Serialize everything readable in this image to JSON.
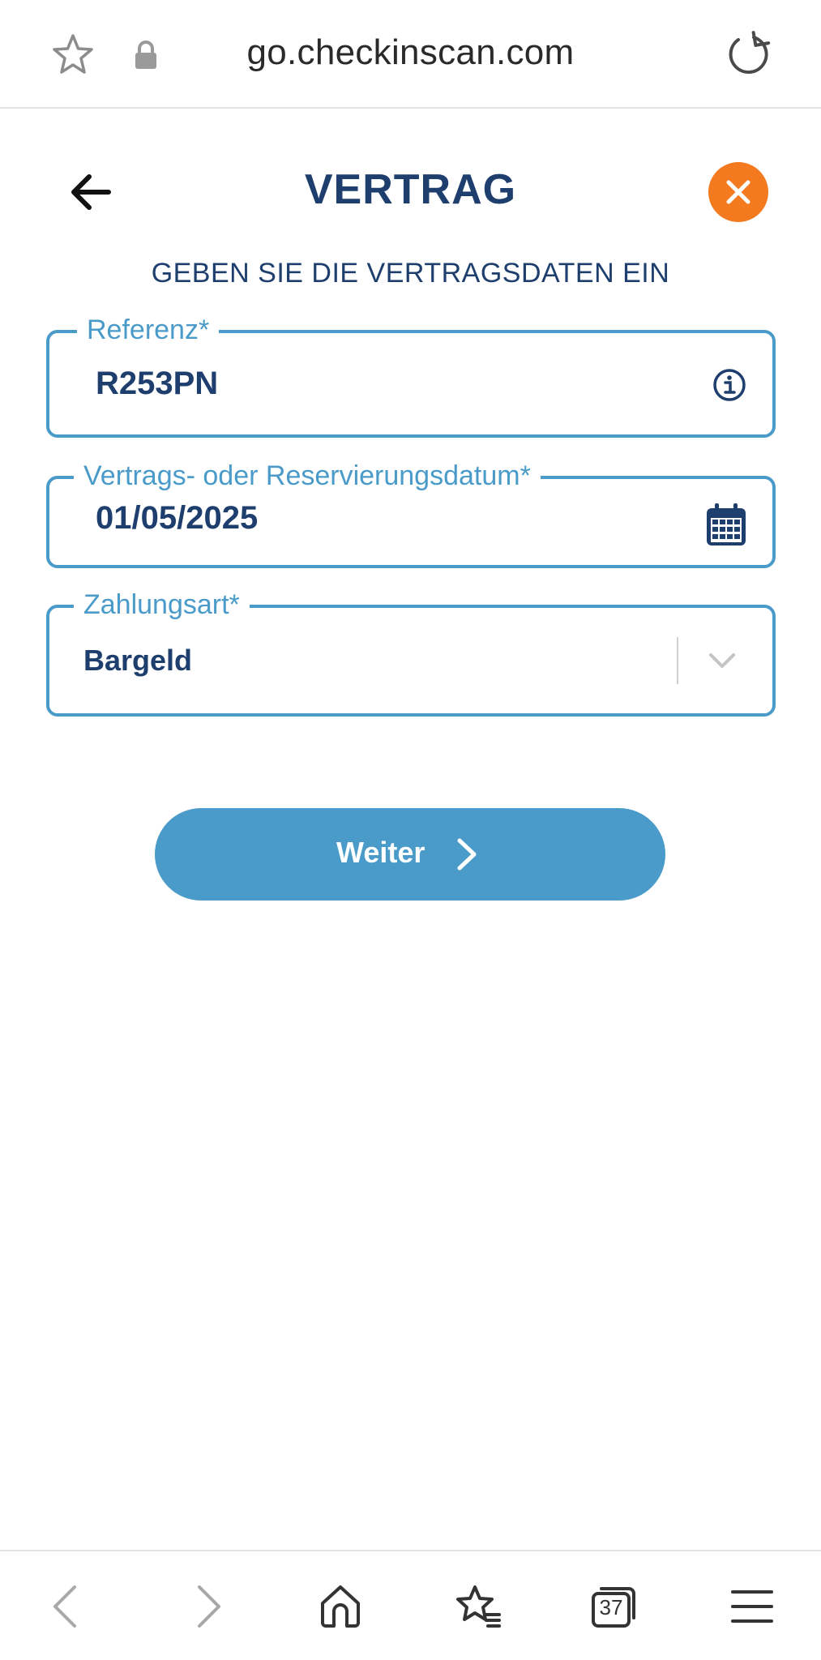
{
  "browser": {
    "url": "go.checkinscan.com",
    "tab_count": "37"
  },
  "header": {
    "title": "VERTRAG",
    "subtitle": "GEBEN SIE DIE VERTRAGSDATEN EIN"
  },
  "form": {
    "reference": {
      "label": "Referenz*",
      "value": "R253PN"
    },
    "date": {
      "label": "Vertrags- oder Reservierungsdatum*",
      "value": "01/05/2025"
    },
    "payment": {
      "label": "Zahlungsart*",
      "value": "Bargeld"
    }
  },
  "actions": {
    "continue_label": "Weiter"
  },
  "colors": {
    "primary": "#4a9bc9",
    "navy": "#1e3f6e",
    "close": "#f47a20"
  },
  "icons": [
    "star-icon",
    "lock-icon",
    "reload-icon",
    "back-arrow-icon",
    "close-icon",
    "info-icon",
    "calendar-icon",
    "chevron-down-icon",
    "chevron-right-icon",
    "home-icon",
    "favorites-icon",
    "tabs-icon",
    "menu-icon"
  ]
}
